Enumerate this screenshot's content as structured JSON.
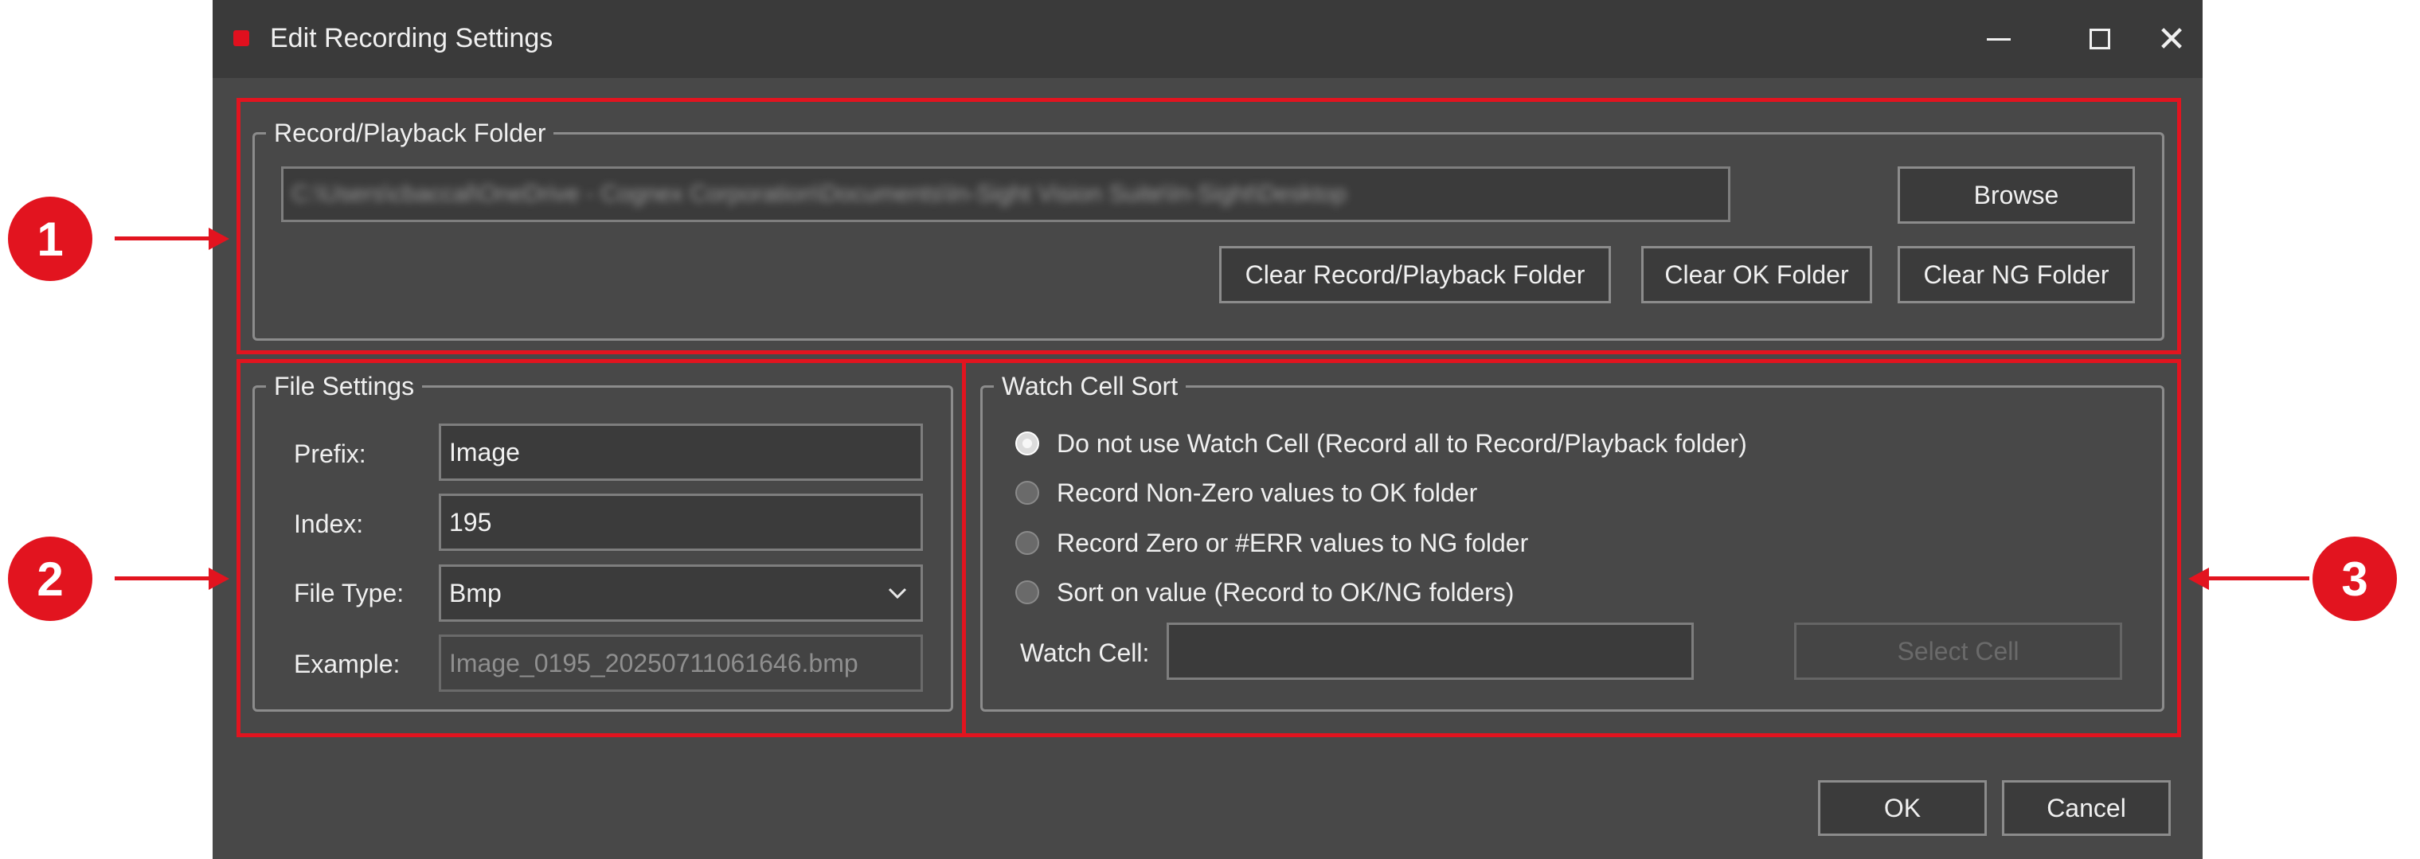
{
  "window": {
    "title": "Edit Recording Settings",
    "controls": {
      "minimize": "minimize-icon",
      "maximize": "maximize-icon",
      "close": "close-icon"
    }
  },
  "record_folder": {
    "legend": "Record/Playback Folder",
    "path_value": "C:\\Users\\cbaccal\\OneDrive - Cognex Corporation\\Documents\\In-Sight Vision Suite\\In-Sight\\Desktop",
    "browse_label": "Browse",
    "clear_record_label": "Clear Record/Playback Folder",
    "clear_ok_label": "Clear OK Folder",
    "clear_ng_label": "Clear NG Folder"
  },
  "file_settings": {
    "legend": "File Settings",
    "prefix_label": "Prefix:",
    "prefix_value": "Image",
    "index_label": "Index:",
    "index_value": "195",
    "file_type_label": "File Type:",
    "file_type_value": "Bmp",
    "example_label": "Example:",
    "example_value": "Image_0195_20250711061646.bmp"
  },
  "watch_cell_sort": {
    "legend": "Watch Cell Sort",
    "options": [
      {
        "label": "Do not use Watch Cell (Record all to Record/Playback folder)",
        "checked": true
      },
      {
        "label": "Record Non-Zero values to OK folder",
        "checked": false
      },
      {
        "label": "Record Zero or #ERR values to NG folder",
        "checked": false
      },
      {
        "label": "Sort on value (Record to OK/NG folders)",
        "checked": false
      }
    ],
    "watch_cell_label": "Watch Cell:",
    "watch_cell_value": "",
    "select_cell_label": "Select Cell"
  },
  "footer": {
    "ok_label": "OK",
    "cancel_label": "Cancel"
  },
  "callouts": [
    "1",
    "2",
    "3"
  ],
  "colors": {
    "annotation_red": "#e2141f",
    "dialog_bg": "#484848",
    "titlebar_bg": "#3a3a3a"
  }
}
